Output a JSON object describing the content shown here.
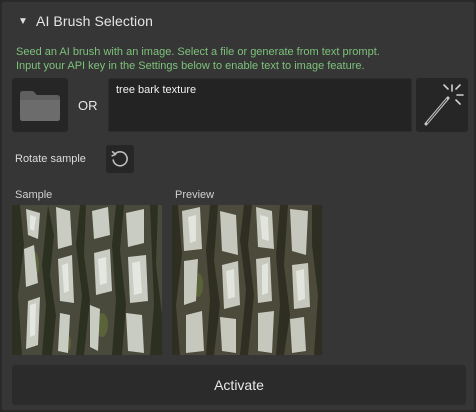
{
  "section": {
    "title": "AI Brush Selection"
  },
  "description": {
    "line1": "Seed an AI brush with an image. Select a file or generate from text prompt.",
    "line2": "Input your API key in the Settings below to enable text to image feature."
  },
  "source": {
    "or_label": "OR",
    "prompt_value": "tree bark texture"
  },
  "rotate": {
    "label": "Rotate sample"
  },
  "images": {
    "sample_label": "Sample",
    "preview_label": "Preview"
  },
  "actions": {
    "activate_label": "Activate"
  },
  "colors": {
    "accent_text": "#7dc27a",
    "panel_bg": "#363636",
    "well_bg": "#262626"
  },
  "icons": {
    "collapse": "triangle-down-icon",
    "folder": "folder-icon",
    "generate": "magic-wand-icon",
    "rotate": "rotate-ccw-icon"
  }
}
